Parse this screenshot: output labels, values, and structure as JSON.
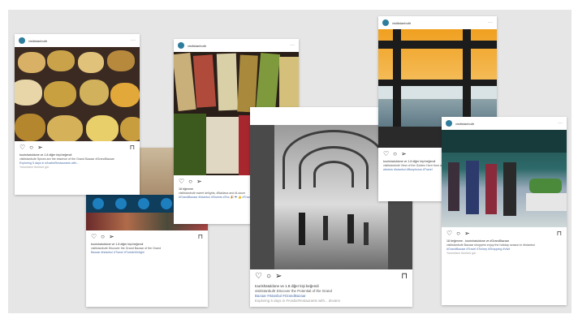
{
  "posts": [
    {
      "id": "post-1",
      "username": "visitistanbultr",
      "liked_by": "tourishatuldone ve 1.8 diğer kişi beğendi",
      "caption": "visitistanbultr Spices are the essence of the Grand Bazaar #GrandBazaar",
      "tags": "Exploring 5 days in #ArabicRestaurants with...",
      "comments": "Yorumların tümünü gör"
    },
    {
      "id": "post-2",
      "username": "visitistanbultr",
      "liked_by": "tourishatuldone ve 1.8 diğer kişi beğendi",
      "caption": "visitistanbultr Discover the Grand Bazaar of the Grand",
      "tags": "Bazaar #Istanbul #Travel #TurkishDelight",
      "comments": ""
    },
    {
      "id": "post-3",
      "username": "visitistanbultr",
      "liked_by": "18 bğenme",
      "caption": "visitistanbultr sweet delights, #Baklava and #Lokum",
      "tags": "#GrandBazaar #Istanbul #Sweets #Tea 🎉 ❤ 👍 #Travel",
      "comments": ""
    },
    {
      "id": "post-4",
      "username": "visitistanbultr",
      "liked_by": "tourishatuldone ve 1.8 diğer kişi beğendi",
      "caption": "visitistanbultr Discover the Potential of the Grand",
      "tags": "Bazaar #Istanbul #GrandBazaar",
      "comments": "Exploring 5 days in #ArabicRestaurants with... devamı"
    },
    {
      "id": "post-5",
      "username": "visitistanbultr",
      "liked_by": "tourishatuldone ve 1.8 diğer kişi beğendi",
      "caption": "visitistanbultr View of the Golden Horn from a",
      "tags": "window #Istanbul #Bosphorus #Travel",
      "comments": ""
    },
    {
      "id": "post-6",
      "username": "visitistanbultr",
      "liked_by": "18 beğenme - tourishatuldone ve #GrandBazaar",
      "caption": "visitistanbultr Bazaar shoppers enjoy the holiday season in #Istanbul",
      "tags": "#GrandBazaar #Travel #Turkey #Shopping #Visit",
      "comments": "Yorumların tümünü gör"
    }
  ],
  "icons": {
    "like": "heart-icon",
    "comment": "comment-icon",
    "share": "share-icon",
    "save": "bookmark-icon",
    "more": "more-icon"
  },
  "colors": {
    "board": "#e6e6e6",
    "avatar": "#2f7d9c",
    "hashtag": "#4a6da7"
  }
}
